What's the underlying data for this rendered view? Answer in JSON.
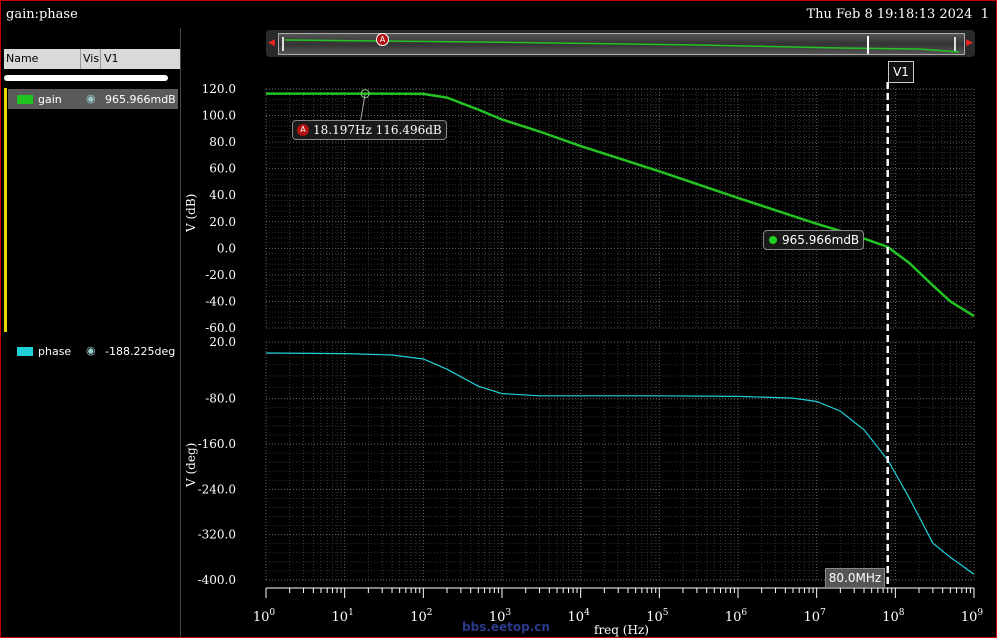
{
  "window": {
    "title": "gain:phase",
    "datetime": "Thu Feb 8 19:18:13 2024",
    "page_index": "1"
  },
  "legend": {
    "headers": [
      "Name",
      "Vis",
      "V1"
    ],
    "traces": [
      {
        "name": "gain",
        "color": "#22c422",
        "value": "965.966mdB",
        "selected": true,
        "icon": "eye-icon"
      },
      {
        "name": "phase",
        "color": "#20d0d8",
        "value": "-188.225deg",
        "selected": false,
        "icon": "eye-icon"
      }
    ]
  },
  "overview": {
    "marker_label": "A",
    "left_arrow": "◀",
    "right_arrow": "▶"
  },
  "cursor": {
    "label": "V1",
    "freq_readout": "80.0MHz",
    "gain_readout": "965.966mdB",
    "freq_hz": 80000000
  },
  "marker_a": {
    "label": "A",
    "readout": "18.197Hz 116.496dB",
    "freq_hz": 18.197,
    "gain_db": 116.496
  },
  "watermark": "bbs.eetop.cn",
  "chart_data": [
    {
      "type": "line",
      "panel": "gain",
      "ylabel": "V (dB)",
      "y_ticks": [
        "120.0",
        "100.0",
        "80.0",
        "60.0",
        "40.0",
        "20.0",
        "0.0",
        "-20.0",
        "-40.0",
        "-60.0"
      ],
      "ylim": [
        -60,
        120
      ],
      "xscale": "log",
      "xlim": [
        1,
        1000000000
      ],
      "grid": true,
      "series": [
        {
          "name": "gain",
          "color": "#22c422",
          "x": [
            1,
            10,
            18.197,
            100,
            200,
            500,
            1000,
            3000,
            10000,
            100000,
            1000000,
            10000000,
            30000000,
            80000000,
            150000000,
            300000000,
            500000000,
            1000000000
          ],
          "y": [
            116.5,
            116.5,
            116.5,
            116.3,
            113.5,
            104.5,
            97.0,
            88.0,
            77.0,
            58.0,
            38.0,
            18.5,
            10.0,
            1.0,
            -11.0,
            -28.0,
            -40.0,
            -51.0
          ]
        }
      ]
    },
    {
      "type": "line",
      "panel": "phase",
      "ylabel": "V (deg)",
      "y_ticks": [
        "20.0",
        "-80.0",
        "-160.0",
        "-240.0",
        "-320.0",
        "-400.0"
      ],
      "ylim": [
        -400,
        20
      ],
      "xscale": "log",
      "xlim": [
        1,
        1000000000
      ],
      "xlabel": "freq (Hz)",
      "x_ticks": [
        "10^0",
        "10^1",
        "10^2",
        "10^3",
        "10^4",
        "10^5",
        "10^6",
        "10^7",
        "10^8",
        "10^9"
      ],
      "grid": true,
      "series": [
        {
          "name": "phase",
          "color": "#20d0d8",
          "x": [
            1,
            10,
            40,
            100,
            200,
            500,
            1000,
            3000,
            10000,
            100000,
            1000000,
            5000000,
            10000000,
            20000000,
            40000000,
            80000000,
            150000000,
            300000000,
            500000000,
            1000000000
          ],
          "y": [
            0.5,
            -0.5,
            -3,
            -10,
            -28,
            -58,
            -71,
            -75,
            -75,
            -75,
            -76,
            -79,
            -85,
            -102,
            -135,
            -188,
            -255,
            -335,
            -360,
            -390
          ]
        }
      ]
    }
  ]
}
